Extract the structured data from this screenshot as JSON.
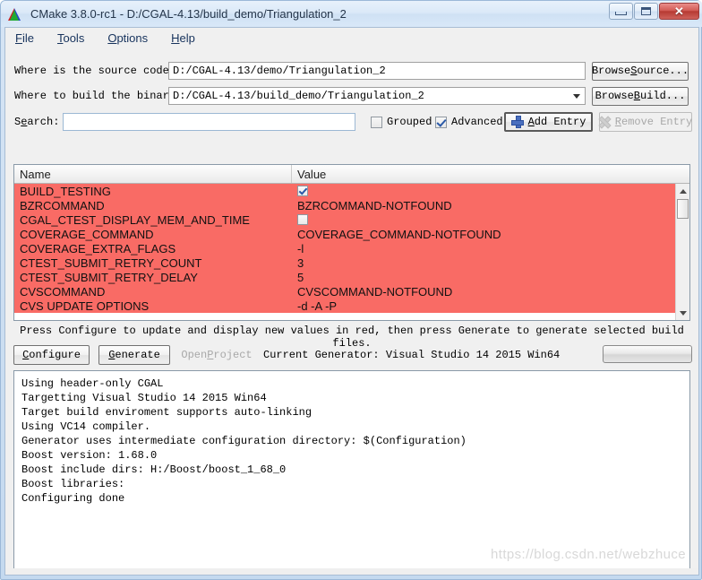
{
  "window": {
    "title": "CMake 3.8.0-rc1 - D:/CGAL-4.13/build_demo/Triangulation_2",
    "icon": "cmake-logo-icon",
    "minimize_label": "–",
    "maximize_label": "□",
    "close_label": "✕"
  },
  "menubar": {
    "items": [
      {
        "accel": "F",
        "rest": "ile"
      },
      {
        "accel": "T",
        "rest": "ools"
      },
      {
        "accel": "O",
        "rest": "ptions"
      },
      {
        "accel": "H",
        "rest": "elp"
      }
    ]
  },
  "form": {
    "source_label": "Where is the source code:",
    "source_value": "D:/CGAL-4.13/demo/Triangulation_2",
    "browse_source": {
      "accel": "S",
      "pre": "Browse ",
      "rest": "ource..."
    },
    "build_label": "Where to build the binaries:",
    "build_value": "D:/CGAL-4.13/build_demo/Triangulation_2",
    "browse_build": {
      "accel": "B",
      "pre": "Browse ",
      "rest": "uild..."
    },
    "search_label_accel": "e",
    "search_label_pre": "S",
    "search_label_rest": "arch:",
    "search_value": "",
    "search_placeholder": "",
    "grouped_label": "Grouped",
    "grouped_checked": false,
    "advanced_label": "Advanced",
    "advanced_checked": true,
    "add_entry": {
      "accel": "A",
      "pre": "",
      "rest": "dd Entry"
    },
    "remove_entry": {
      "accel": "R",
      "pre": "",
      "rest": "emove Entry"
    },
    "remove_entry_disabled": true
  },
  "table": {
    "columns": [
      "Name",
      "Value"
    ],
    "row_highlight_color": "#f96b65",
    "rows": [
      {
        "name": "BUILD_TESTING",
        "value": "",
        "value_type": "checkbox",
        "checked": true
      },
      {
        "name": "BZRCOMMAND",
        "value": "BZRCOMMAND-NOTFOUND",
        "value_type": "text",
        "checked": false
      },
      {
        "name": "CGAL_CTEST_DISPLAY_MEM_AND_TIME",
        "value": "",
        "value_type": "checkbox",
        "checked": false
      },
      {
        "name": "COVERAGE_COMMAND",
        "value": "COVERAGE_COMMAND-NOTFOUND",
        "value_type": "text",
        "checked": false
      },
      {
        "name": "COVERAGE_EXTRA_FLAGS",
        "value": "-l",
        "value_type": "text",
        "checked": false
      },
      {
        "name": "CTEST_SUBMIT_RETRY_COUNT",
        "value": "3",
        "value_type": "text",
        "checked": false
      },
      {
        "name": "CTEST_SUBMIT_RETRY_DELAY",
        "value": "5",
        "value_type": "text",
        "checked": false
      },
      {
        "name": "CVSCOMMAND",
        "value": "CVSCOMMAND-NOTFOUND",
        "value_type": "text",
        "checked": false
      },
      {
        "name": "CVS UPDATE OPTIONS",
        "value": "-d -A -P",
        "value_type": "text",
        "checked": false
      }
    ]
  },
  "actions": {
    "hint": "Press Configure to update and display new values in red, then press Generate to generate selected build files.",
    "configure": {
      "accel": "C",
      "pre": "",
      "rest": "onfigure"
    },
    "generate": {
      "accel": "G",
      "pre": "",
      "rest": "enerate"
    },
    "open_project": {
      "accel": "P",
      "pre": "Open ",
      "rest": "roject"
    },
    "open_project_disabled": true,
    "current_generator": "Current Generator: Visual Studio 14 2015 Win64",
    "progress_percent": 0
  },
  "log": {
    "text": "Using header-only CGAL\nTargetting Visual Studio 14 2015 Win64\nTarget build enviroment supports auto-linking\nUsing VC14 compiler.\nGenerator uses intermediate configuration directory: $(Configuration)\nBoost version: 1.68.0\nBoost include dirs: H:/Boost/boost_1_68_0\nBoost libraries:\nConfiguring done"
  },
  "watermark": {
    "text": "https://blog.csdn.net/webzhuce"
  }
}
